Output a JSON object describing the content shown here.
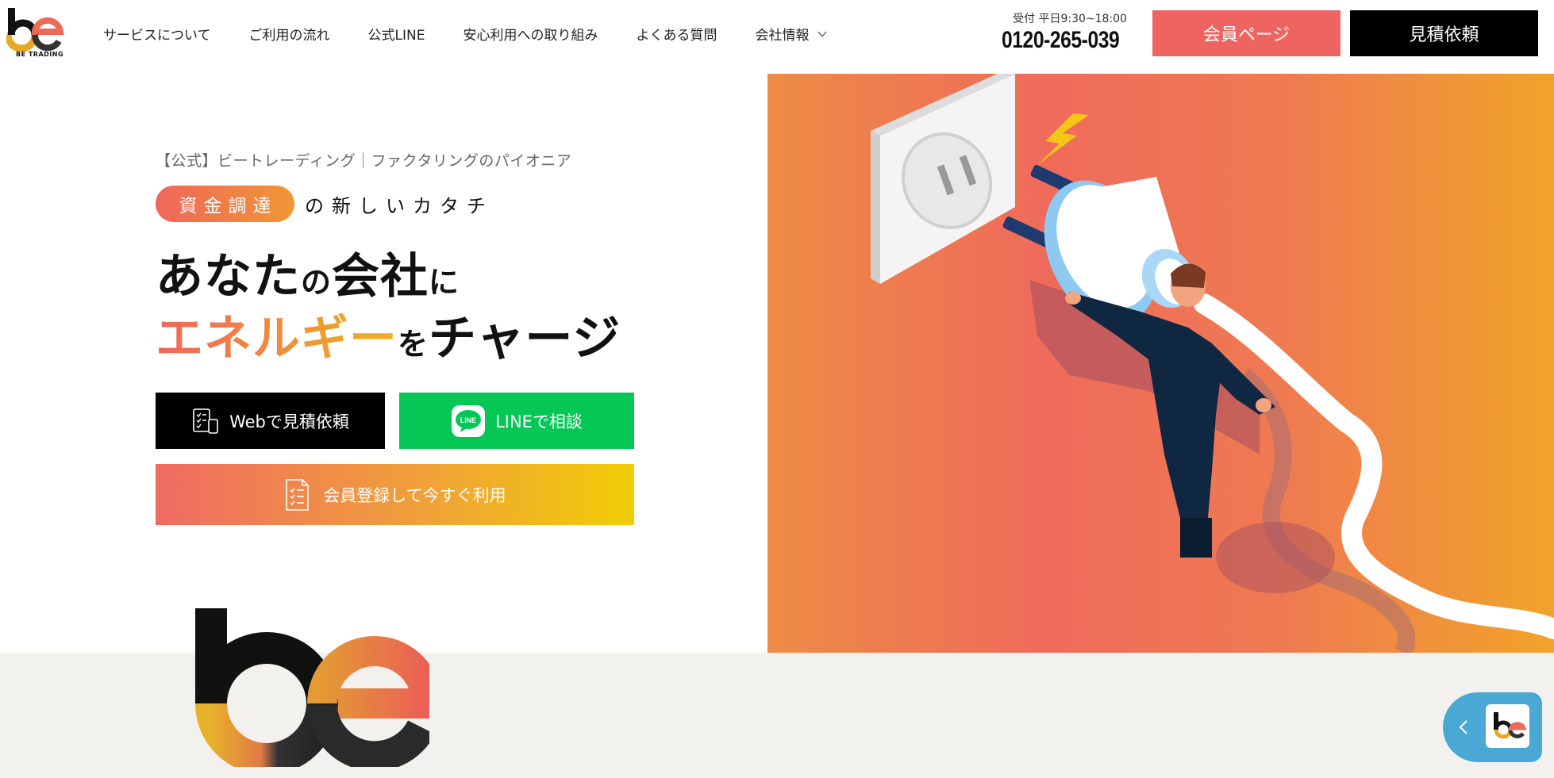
{
  "header": {
    "logo_sub": "BE TRADING",
    "nav": [
      {
        "label": "サービスについて"
      },
      {
        "label": "ご利用の流れ"
      },
      {
        "label": "公式LINE"
      },
      {
        "label": "安心利用への取り組み"
      },
      {
        "label": "よくある質問"
      },
      {
        "label": "会社情報"
      }
    ],
    "hours": "受付 平日9:30~18:00",
    "phone": "0120-265-039",
    "member_button": "会員ページ",
    "quote_button": "見積依頼"
  },
  "hero": {
    "eyebrow": "【公式】ビートレーディング｜ファクタリングのパイオニア",
    "pill": "資金調達",
    "pill_after": "の新しいカタチ",
    "line1_a": "あなた",
    "line1_b": "の",
    "line1_c": "会社",
    "line1_d": "に",
    "line2_a": "エネルギー",
    "line2_b": "を",
    "line2_c": "チャージ",
    "cta_web": "Webで見積依頼",
    "cta_line": "LINEで相談",
    "line_icon_text": "LINE",
    "cta_register": "会員登録して今すぐ利用"
  },
  "colors": {
    "accent_red": "#ee6461",
    "line_green": "#06c755",
    "orange": "#f09734",
    "yellow": "#f1cd06",
    "chat_blue": "#4aa8d4"
  },
  "icons": [
    "chevron-down-icon",
    "document-phone-icon",
    "line-icon",
    "checklist-icon",
    "chevron-left-icon"
  ]
}
